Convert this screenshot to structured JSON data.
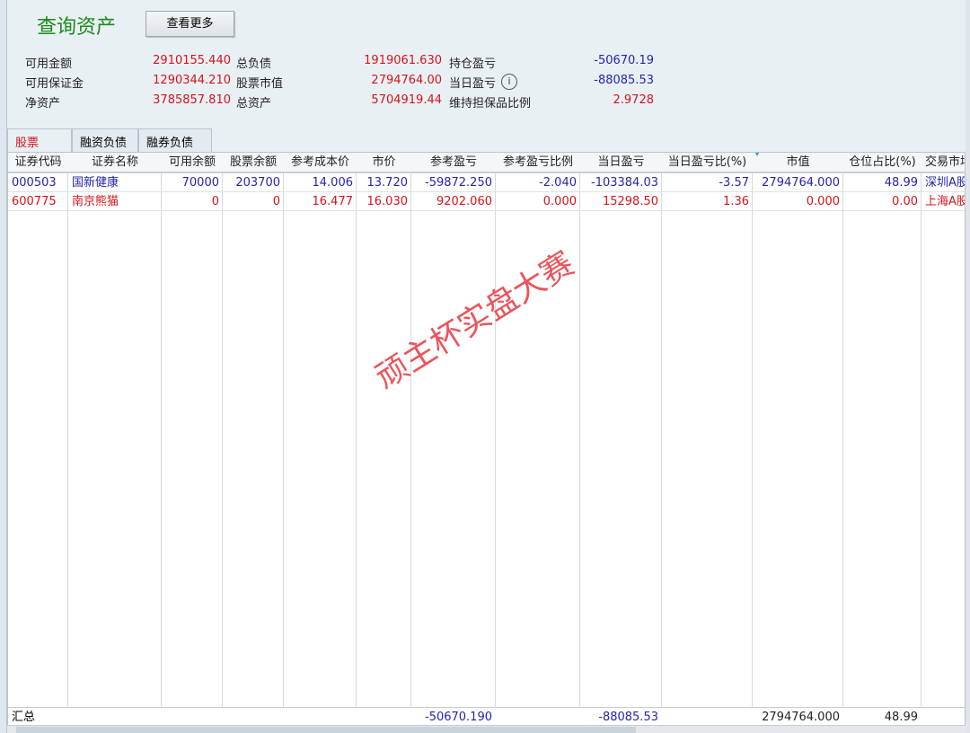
{
  "title": "查询资产",
  "more_button": "查看更多",
  "summary": [
    [
      {
        "label": "可用金额",
        "value": "2910155.440"
      },
      {
        "label": "总负债",
        "value": "1919061.630"
      },
      {
        "label": "持仓盈亏",
        "value": "-50670.19"
      }
    ],
    [
      {
        "label": "可用保证金",
        "value": "1290344.210"
      },
      {
        "label": "股票市值",
        "value": "2794764.00"
      },
      {
        "label": "当日盈亏",
        "value": "-88085.53"
      }
    ],
    [
      {
        "label": "净资产",
        "value": "3785857.810"
      },
      {
        "label": "总资产",
        "value": "5704919.44"
      },
      {
        "label": "维持担保品比例",
        "value": "2.9728"
      }
    ]
  ],
  "tabs": [
    "股票",
    "融资负债",
    "融券负债"
  ],
  "columns": [
    "证券代码",
    "证券名称",
    "可用余额",
    "股票余额",
    "参考成本价",
    "市价",
    "参考盈亏",
    "参考盈亏比例",
    "当日盈亏",
    "当日盈亏比(%)",
    "市值",
    "仓位占比(%)",
    "交易市场"
  ],
  "rows": [
    {
      "color": "#2424b0",
      "cells": [
        "000503",
        "国新健康",
        "70000",
        "203700",
        "14.006",
        "13.720",
        "-59872.250",
        "-2.040",
        "-103384.03",
        "-3.57",
        "2794764.000",
        "48.99",
        "深圳A股"
      ]
    },
    {
      "color": "#d4141c",
      "cells": [
        "600775",
        "南京熊猫",
        "0",
        "0",
        "16.477",
        "16.030",
        "9202.060",
        "0.000",
        "15298.50",
        "1.36",
        "0.000",
        "0.00",
        "上海A股"
      ]
    }
  ],
  "total": {
    "label": "汇总",
    "cells": [
      "",
      "",
      "",
      "",
      "",
      "-50670.190",
      "",
      "-88085.53",
      "",
      "2794764.000",
      "48.99",
      ""
    ]
  },
  "watermark": "顽主杯实盘大赛",
  "colors": {
    "title": "#1a8a1a",
    "positive": "#d4141c",
    "negative": "#2424b0"
  }
}
